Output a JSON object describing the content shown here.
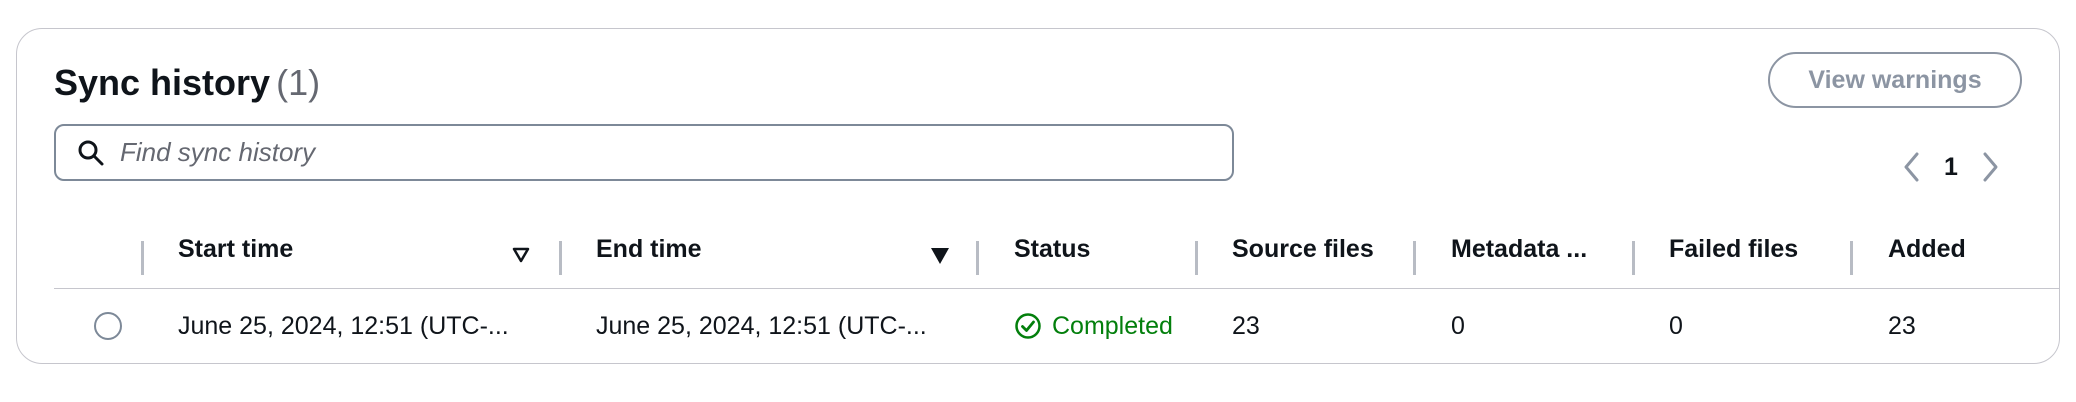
{
  "header": {
    "title": "Sync history",
    "count": "(1)",
    "view_warnings_label": "View warnings"
  },
  "search": {
    "placeholder": "Find sync history",
    "value": ""
  },
  "pagination": {
    "current_page": "1"
  },
  "table": {
    "columns": [
      "Start time",
      "End time",
      "Status",
      "Source files",
      "Metadata ...",
      "Failed files",
      "Added"
    ],
    "rows": [
      {
        "start_time": "June 25, 2024, 12:51 (UTC-...",
        "end_time": "June 25, 2024, 12:51 (UTC-...",
        "status": "Completed",
        "source_files": "23",
        "metadata": "0",
        "failed_files": "0",
        "added": "23"
      }
    ]
  },
  "icons": {
    "search": "search-icon",
    "prev": "chevron-left-icon",
    "next": "chevron-right-icon",
    "sort_default": "sort-caret-outline-icon",
    "sort_active": "sort-caret-filled-icon",
    "status_success": "check-circle-icon"
  },
  "colors": {
    "success": "#037f0c",
    "disabled": "#8c95a3",
    "border": "#c6c6cd",
    "text": "#0f141a",
    "muted": "#656871"
  }
}
